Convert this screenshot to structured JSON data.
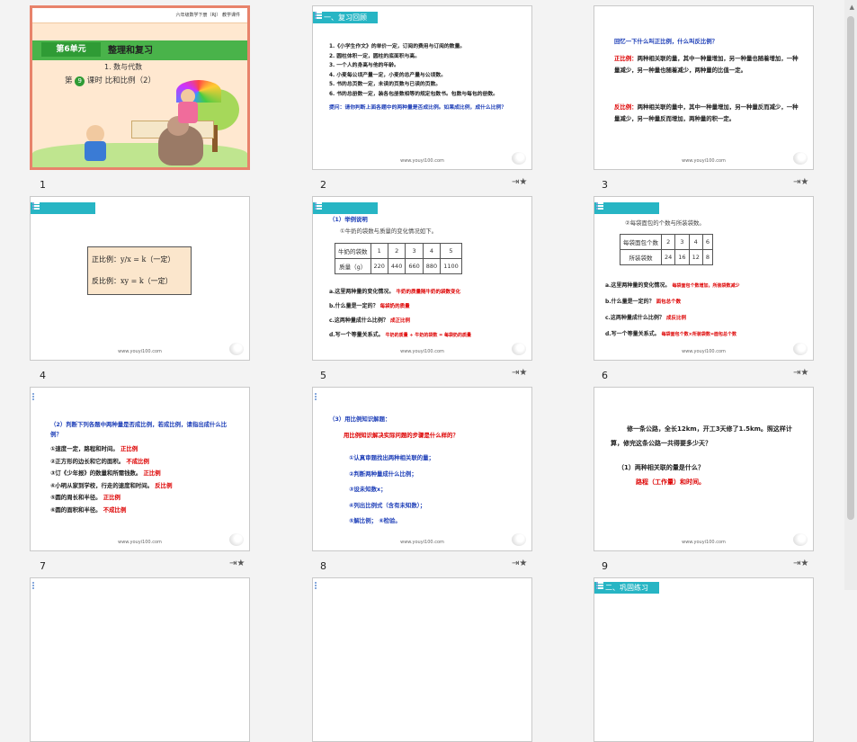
{
  "slides": [
    {
      "number": "1",
      "header": "六年级数学下册（RJ）  教学课件",
      "unit": "第6单元",
      "unit_title": "整理和复习",
      "section": "1. 数与代数",
      "lesson_prefix": "第",
      "lesson_num": "9",
      "lesson_suffix": "课时  比和比例（2）"
    },
    {
      "number": "2",
      "bar": "一、复习回顾",
      "lines": [
        "1.《小学生作文》的单价一定，订阅的费用与订阅的数量。",
        "2. 圆柱体积一定，圆柱的底面积与高。",
        "3. 一个人的身高与他的年龄。",
        "4. 小麦每公顷产量一定，小麦的总产量与公顷数。",
        "5. 书的总页数一定，未读的页数与已读的页数。",
        "6. 书的总册数一定，装各包册数相等的规定包数书。包数与每包的册数。"
      ],
      "prompt": "提问：请你判断上面各题中的两种量是否成比例。如果成比例，成什么比例？",
      "footer": "www.youyi100.com"
    },
    {
      "number": "3",
      "title": "回忆一下什么叫正比例，什么叫反比例？",
      "zheng_label": "正比例：",
      "zheng": "两种相关联的量，其中一种量增加，另一种量也随着增加，一种量减少，另一种量也随着减少，两种量的比值一定。",
      "fan_label": "反比例：",
      "fan": "两种相关联的量中，其中一种量增加，另一种量反而减少，一种量减少，另一种量反而增加，两种量的积一定。",
      "footer": "www.youyi100.com"
    },
    {
      "number": "4",
      "formula1": "正比例：y/x = k（一定）",
      "formula2": "反比例：xy = k（一定）",
      "footer": "www.youyi100.com"
    },
    {
      "number": "5",
      "heading": "（1）举例说明",
      "subheading": "①牛奶的袋数与质量的变化情况如下。",
      "row1": [
        "牛奶的袋数",
        "1",
        "2",
        "3",
        "4",
        "5"
      ],
      "row2": [
        "质量（g）",
        "220",
        "440",
        "660",
        "880",
        "1100"
      ],
      "qa": [
        [
          "a.这里两种量的变化情况。",
          "牛奶的质量随牛奶的袋数变化"
        ],
        [
          "b.什么量是一定的？",
          "每袋奶的质量"
        ],
        [
          "c.这两种量成什么比例？",
          "成正比例"
        ],
        [
          "d.写一个等量关系式。",
          "牛奶的质量 ÷ 牛奶的袋数 = 每袋奶的质量"
        ]
      ],
      "footer": "www.youyi100.com"
    },
    {
      "number": "6",
      "subheading": "②每袋面包的个数与所装袋数。",
      "row1": [
        "每袋面包个数",
        "2",
        "3",
        "4",
        "6"
      ],
      "row2": [
        "所装袋数",
        "24",
        "16",
        "12",
        "8"
      ],
      "qa": [
        [
          "a.这里两种量的变化情况。",
          "每袋面包个数增加，所装袋数减少"
        ],
        [
          "b.什么量是一定的？",
          "面包总个数"
        ],
        [
          "c.这两种量成什么比例？",
          "成反比例"
        ],
        [
          "d.写一个等量关系式。",
          "每袋面包个数×所装袋数=面包总个数"
        ]
      ],
      "footer": "www.youyi100.com"
    },
    {
      "number": "7",
      "title": "（2）判断下列各题中两种量是否成比例，若成比例，请指出成什么比例？",
      "items": [
        [
          "①速度一定，路程和时间。",
          "正比例"
        ],
        [
          "②正方形的边长和它的面积。",
          "不成比例"
        ],
        [
          "③订《少年报》的数量和所需钱数。",
          "正比例"
        ],
        [
          "④小明从家到学校，行走的速度和时间。",
          "反比例"
        ],
        [
          "⑤圆的周长和半径。",
          "正比例"
        ],
        [
          "⑥圆的面积和半径。",
          "不成比例"
        ]
      ],
      "footer": "www.youyi100.com"
    },
    {
      "number": "8",
      "title": "（3）用比例知识解题：",
      "question": "用比例知识解决实际问题的步骤是什么样的？",
      "steps": [
        "①认真审题找出两种相关联的量；",
        "②判断两种量成什么比例；",
        "③设未知数x；",
        "④列出比例式（含有未知数）；",
        "⑤解比例；      ⑥检验。"
      ],
      "footer": "www.youyi100.com"
    },
    {
      "number": "9",
      "problem": "修一条公路，全长12km，开工3天修了1.5km。照这样计算，修完这条公路一共得要多少天？",
      "q1": "（1）两种相关联的量是什么？",
      "a1": "路程（工作量）和时间。",
      "footer": "www.youyi100.com"
    },
    {
      "number": "10"
    },
    {
      "number": "11"
    },
    {
      "number": "12",
      "bar": "二、巩固练习"
    }
  ],
  "icons": {
    "star": "star-icon",
    "swirl": "swirl-icon"
  }
}
